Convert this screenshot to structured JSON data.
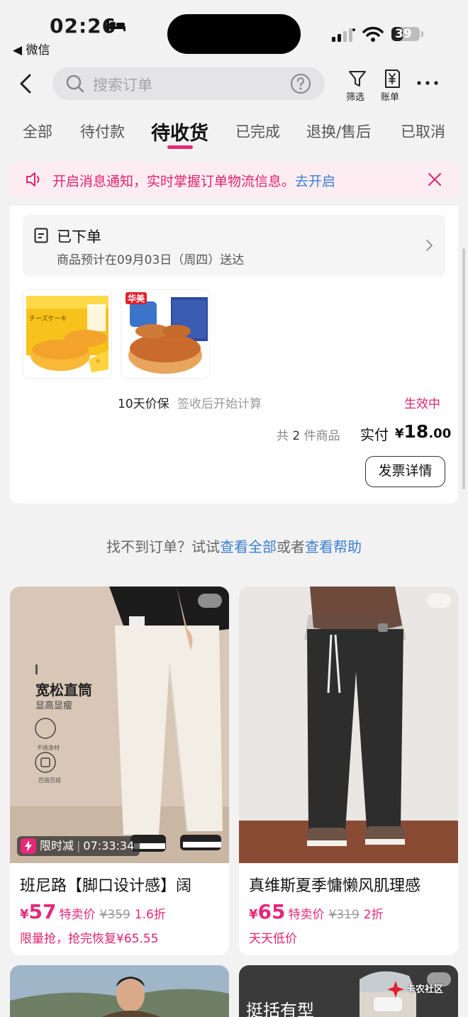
{
  "status_bar": {
    "time": "02:26",
    "back_app": "◀ 微信",
    "battery": "39"
  },
  "header": {
    "search_placeholder": "搜索订单",
    "filter_label": "筛选",
    "bill_label": "账单"
  },
  "tabs": [
    {
      "label": "全部"
    },
    {
      "label": "待付款"
    },
    {
      "label": "待收货",
      "active": true
    },
    {
      "label": "已完成"
    },
    {
      "label": "退换/售后"
    },
    {
      "label": "已取消"
    }
  ],
  "notice": {
    "text": "开启消息通知，实时掌握订单物流信息。",
    "link": "去开启"
  },
  "order": {
    "status_title": "已下单",
    "status_sub": "商品预计在09月03日（周四）送达",
    "guarantee": "10天价保",
    "guarantee_sub": "签收后开始计算",
    "effective": "生效中",
    "count_prefix": "共",
    "count": "2",
    "count_suffix": "件商品",
    "paid_label": "实付",
    "paid_currency": "¥",
    "paid_int": "18",
    "paid_dec": ".00",
    "invoice_button": "发票详情",
    "product_badge_2": "华美",
    "product_text_1": "チーズケーキ"
  },
  "not_found": {
    "text": "找不到订单？试试",
    "link1": "查看全部",
    "mid": "或者",
    "link2": "查看帮助"
  },
  "products": [
    {
      "name": "班尼路【脚口设计感】阔",
      "currency": "¥",
      "price": "57",
      "tag": "特卖价",
      "orig": "¥359",
      "discount": "1.6折",
      "sub": "限量抢，抢完恢复¥65.55",
      "flash_label": "限时减",
      "flash_time": "07:33:34",
      "overlay_title": "宽松直筒",
      "overlay_sub": "显高显瘦",
      "overlay_f1": "不挑身材",
      "overlay_f2": "百搭百搭"
    },
    {
      "name": "真维斯夏季慵懒风肌理感",
      "currency": "¥",
      "price": "65",
      "tag": "特卖价",
      "orig": "¥319",
      "discount": "2折",
      "sub": "天天低价"
    },
    {
      "overlay_title": ""
    },
    {
      "overlay_title": "挺括有型"
    }
  ],
  "watermark": "卡农社区"
}
